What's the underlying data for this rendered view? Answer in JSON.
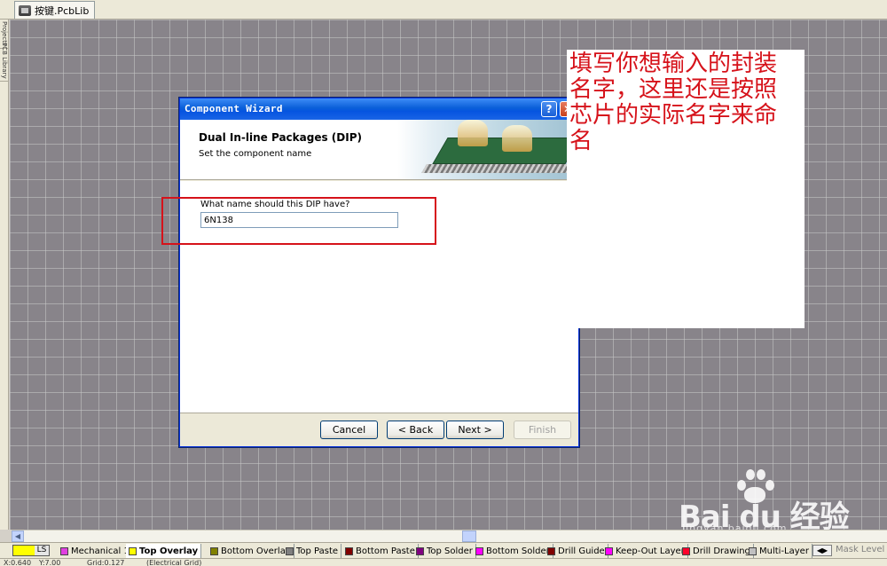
{
  "document_tab": {
    "label": "按键.PcbLib"
  },
  "side_panel": {
    "tabs": [
      "Projects",
      "PCB Library"
    ]
  },
  "dialog": {
    "title": "Component Wizard",
    "help_glyph": "?",
    "close_glyph": "✕",
    "header_title": "Dual In-line Packages (DIP)",
    "header_subtitle": "Set the component name",
    "question": "What name should this DIP have?",
    "name_value": "6N138",
    "buttons": {
      "cancel": "Cancel",
      "back": "< Back",
      "next": "Next >",
      "finish": "Finish"
    }
  },
  "annotation": {
    "text": "填写你想输入的封装名字，这里还是按照芯片的实际名字来命名",
    "color": "#d6121a"
  },
  "layers": {
    "ls_label": "LS",
    "items": [
      {
        "label": "Mechanical 1",
        "color": "#e040e0"
      },
      {
        "label": "Top Overlay",
        "color": "#ffff00",
        "active": true
      },
      {
        "label": "Bottom Overlay",
        "color": "#808000"
      },
      {
        "label": "Top Paste",
        "color": "#808080"
      },
      {
        "label": "Bottom Paste",
        "color": "#800000"
      },
      {
        "label": "Top Solder",
        "color": "#800080"
      },
      {
        "label": "Bottom Solder",
        "color": "#ff00ff"
      },
      {
        "label": "Drill Guide",
        "color": "#800000"
      },
      {
        "label": "Keep-Out Layer",
        "color": "#ff00ff"
      },
      {
        "label": "Drill Drawing",
        "color": "#ff002a"
      },
      {
        "label": "Multi-Layer",
        "color": "#c0c0c0"
      }
    ],
    "mask_level": "Mask Level"
  },
  "status": {
    "x": "X:0.640",
    "y": "Y:7.00",
    "grid": "Grid:0.127",
    "snap": "(Electrical Grid)"
  },
  "watermark": {
    "brand": "Bai du 经验",
    "url": "jingyan.baidu.com"
  }
}
